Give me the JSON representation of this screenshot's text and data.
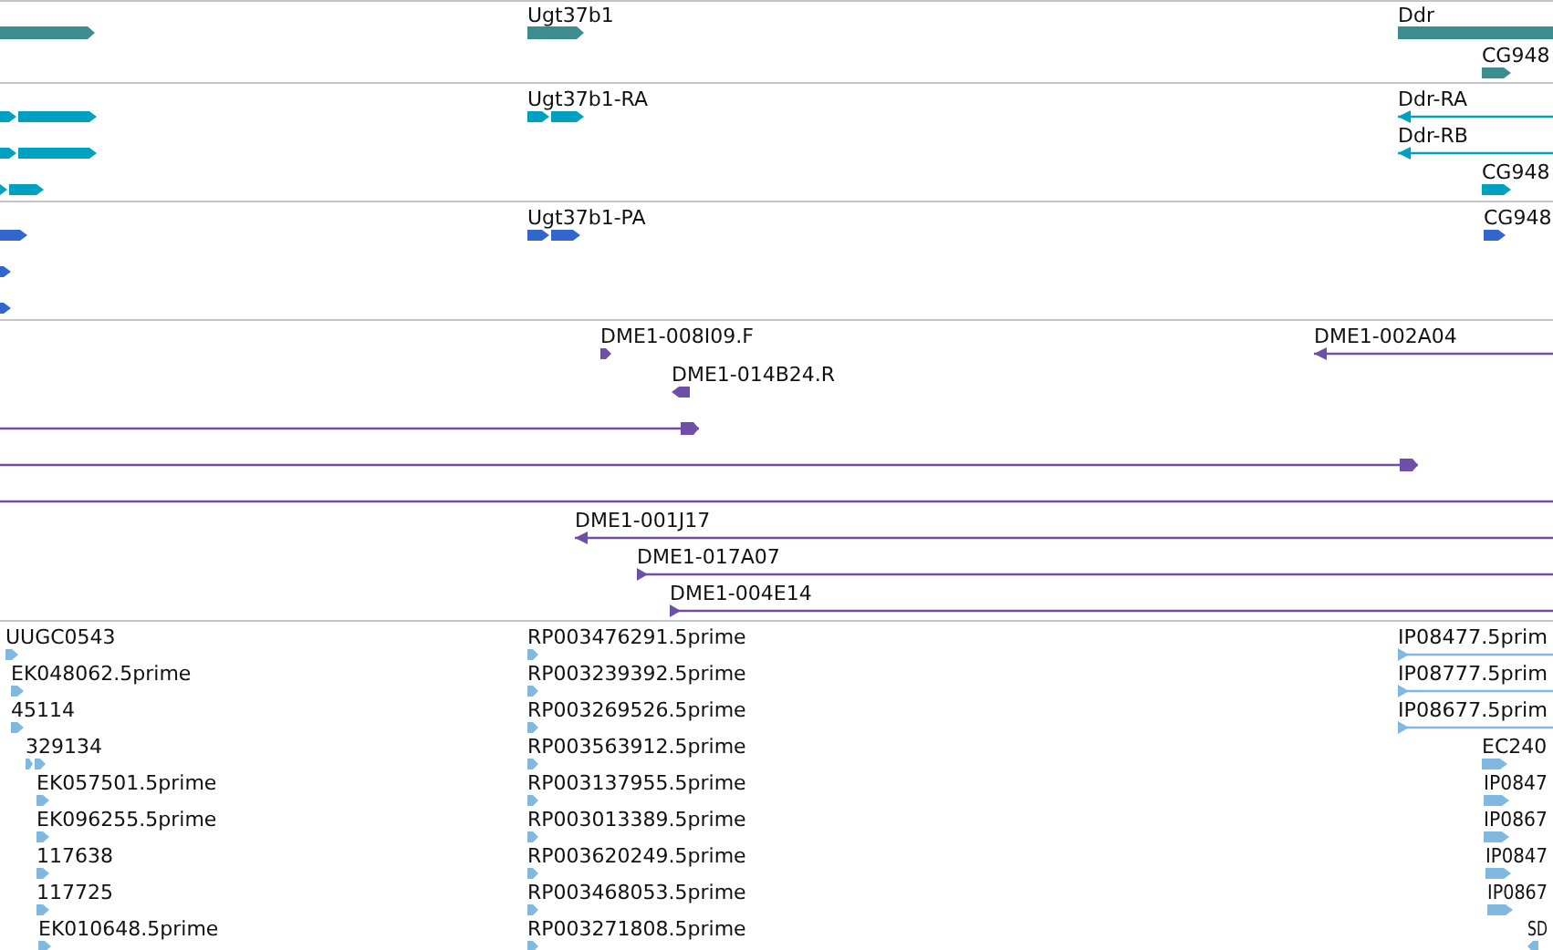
{
  "tracks": [
    {
      "color": "#3d8c8f",
      "features": [
        {
          "kind": "bar",
          "reverse": false
        },
        {
          "label": "Ugt37b1",
          "kind": "bar",
          "reverse": false
        },
        {
          "label": "Ddr",
          "kind": "bar",
          "reverse": false
        },
        {
          "label": "CG948",
          "kind": "arrow",
          "reverse": false
        }
      ]
    },
    {
      "color": "#00a0c0",
      "features": [
        {
          "kind": "exons",
          "reverse": false
        },
        {
          "kind": "exons",
          "reverse": false
        },
        {
          "kind": "exons",
          "reverse": false
        },
        {
          "label": "Ugt37b1-RA",
          "kind": "exons",
          "reverse": false
        },
        {
          "label": "Ddr-RA",
          "kind": "line",
          "reverse": true
        },
        {
          "label": "Ddr-RB",
          "kind": "line",
          "reverse": true
        },
        {
          "label": "CG948",
          "kind": "arrow",
          "reverse": false
        }
      ]
    },
    {
      "color": "#3366cc",
      "features": [
        {
          "kind": "arrow",
          "reverse": false
        },
        {
          "kind": "arrow",
          "reverse": false
        },
        {
          "kind": "arrow",
          "reverse": false
        },
        {
          "label": "Ugt37b1-PA",
          "kind": "exons",
          "reverse": false
        },
        {
          "label": "CG948",
          "kind": "arrow",
          "reverse": false
        }
      ]
    },
    {
      "color": "#6e50a8",
      "features": [
        {
          "label": "DME1-008I09.F",
          "kind": "arrow",
          "reverse": false
        },
        {
          "label": "DME1-002A04",
          "kind": "line",
          "reverse": true
        },
        {
          "label": "DME1-014B24.R",
          "kind": "arrow",
          "reverse": true
        },
        {
          "kind": "line",
          "reverse": false
        },
        {
          "kind": "line",
          "reverse": false
        },
        {
          "kind": "line"
        },
        {
          "label": "DME1-001J17",
          "kind": "line",
          "reverse": true
        },
        {
          "label": "DME1-017A07",
          "kind": "line",
          "reverse": false
        },
        {
          "label": "DME1-004E14",
          "kind": "line",
          "reverse": false
        }
      ]
    },
    {
      "color": "#80b8e0",
      "features": [
        {
          "label": "UUGC0543",
          "kind": "arrow",
          "reverse": false
        },
        {
          "label": "RP003476291.5prime",
          "kind": "arrow",
          "reverse": false
        },
        {
          "label": "IP08477.5prim",
          "kind": "line",
          "reverse": false
        },
        {
          "label": "EK048062.5prime",
          "kind": "arrow",
          "reverse": false
        },
        {
          "label": "RP003239392.5prime",
          "kind": "arrow",
          "reverse": false
        },
        {
          "label": "IP08777.5prim",
          "kind": "line",
          "reverse": false
        },
        {
          "label": "45114",
          "kind": "arrow",
          "reverse": false
        },
        {
          "label": "RP003269526.5prime",
          "kind": "arrow",
          "reverse": false
        },
        {
          "label": "IP08677.5prim",
          "kind": "line",
          "reverse": false
        },
        {
          "label": "329134",
          "kind": "exons",
          "reverse": false
        },
        {
          "label": "RP003563912.5prime",
          "kind": "arrow",
          "reverse": false
        },
        {
          "label": "EC240",
          "kind": "arrow",
          "reverse": false
        },
        {
          "label": "EK057501.5prime",
          "kind": "arrow",
          "reverse": false
        },
        {
          "label": "RP003137955.5prime",
          "kind": "arrow",
          "reverse": false
        },
        {
          "label": "IP0847",
          "kind": "arrow",
          "reverse": false
        },
        {
          "label": "EK096255.5prime",
          "kind": "arrow",
          "reverse": false
        },
        {
          "label": "RP003013389.5prime",
          "kind": "arrow",
          "reverse": false
        },
        {
          "label": "IP0867",
          "kind": "arrow",
          "reverse": false
        },
        {
          "label": "117638",
          "kind": "arrow",
          "reverse": false
        },
        {
          "label": "RP003620249.5prime",
          "kind": "arrow",
          "reverse": false
        },
        {
          "label": "IP0847",
          "kind": "arrow",
          "reverse": false
        },
        {
          "label": "117725",
          "kind": "arrow",
          "reverse": false
        },
        {
          "label": "RP003468053.5prime",
          "kind": "arrow",
          "reverse": false
        },
        {
          "label": "IP0867",
          "kind": "arrow",
          "reverse": false
        },
        {
          "label": "EK010648.5prime",
          "kind": "arrow",
          "reverse": false
        },
        {
          "label": "RP003271808.5prime",
          "kind": "arrow",
          "reverse": false
        },
        {
          "label": "SD",
          "kind": "arrow",
          "reverse": true
        }
      ]
    }
  ]
}
